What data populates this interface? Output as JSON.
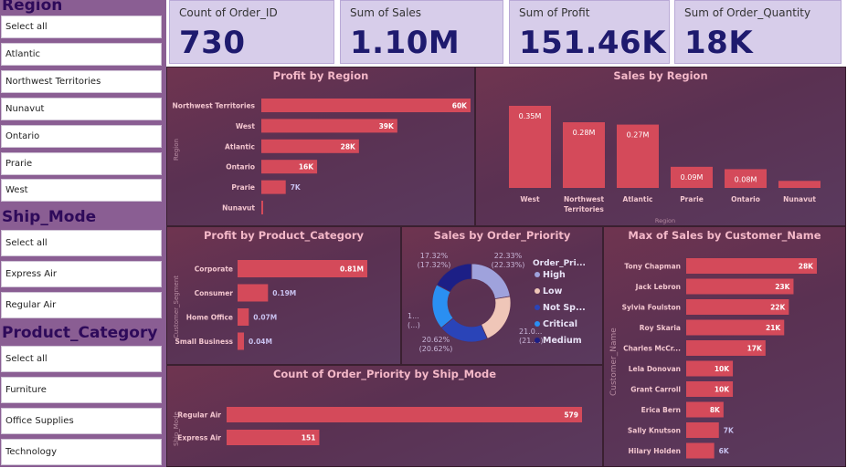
{
  "slicers": {
    "region": {
      "title": "Region",
      "items": [
        "Select all",
        "Atlantic",
        "Northwest Territories",
        "Nunavut",
        "Ontario",
        "Prarie",
        "West"
      ]
    },
    "ship_mode": {
      "title": "Ship_Mode",
      "items": [
        "Select all",
        "Express Air",
        "Regular Air"
      ]
    },
    "product_category": {
      "title": "Product_Category",
      "items": [
        "Select all",
        "Furniture",
        "Office Supplies",
        "Technology"
      ]
    }
  },
  "kpis": [
    {
      "label": "Count of Order_ID",
      "value": "730"
    },
    {
      "label": "Sum of Sales",
      "value": "1.10M"
    },
    {
      "label": "Sum of Profit",
      "value": "151.46K"
    },
    {
      "label": "Sum of Order_Quantity",
      "value": "18K"
    }
  ],
  "colors": {
    "bar": "#d44a5a",
    "slicer_bg": "#8a5e93",
    "kpi_bg": "#d7cdea",
    "kpi_value": "#1e1a6e",
    "title": "#f4b8c8"
  },
  "panels": {
    "profit_by_region": {
      "title": "Profit by Region",
      "axis_label": "Region"
    },
    "sales_by_region": {
      "title": "Sales by Region",
      "axis_label": "Region"
    },
    "profit_by_category": {
      "title": "Profit by Product_Category",
      "axis_label": "Customer_Segment"
    },
    "sales_by_priority": {
      "title": "Sales by Order_Priority",
      "legend_title": "Order_Pri..."
    },
    "max_sales_customer": {
      "title": "Max of Sales by Customer_Name",
      "axis_label": "Customer_Name"
    },
    "priority_by_ship": {
      "title": "Count of Order_Priority by Ship_Mode",
      "axis_label": "Ship_Mode"
    }
  },
  "chart_data": [
    {
      "id": "profit_by_region",
      "type": "bar",
      "orientation": "horizontal",
      "title": "Profit by Region",
      "ylabel": "Region",
      "categories": [
        "Northwest Territories",
        "West",
        "Atlantic",
        "Ontario",
        "Prarie",
        "Nunavut"
      ],
      "values": [
        60000,
        39000,
        28000,
        16000,
        7000,
        500
      ],
      "labels": [
        "60K",
        "39K",
        "28K",
        "16K",
        "7K",
        ""
      ],
      "xlim": [
        0,
        60000
      ]
    },
    {
      "id": "sales_by_region",
      "type": "bar",
      "orientation": "vertical",
      "title": "Sales by Region",
      "xlabel": "Region",
      "categories": [
        "West",
        "Northwest\nTerritories",
        "Atlantic",
        "Prarie",
        "Ontario",
        "Nunavut"
      ],
      "values": [
        0.35,
        0.28,
        0.27,
        0.09,
        0.08,
        0.03
      ],
      "labels": [
        "0.35M",
        "0.28M",
        "0.27M",
        "0.09M",
        "0.08M",
        ""
      ],
      "ylim": [
        0,
        0.35
      ]
    },
    {
      "id": "profit_by_category",
      "type": "bar",
      "orientation": "horizontal",
      "title": "Profit by Product_Category",
      "ylabel": "Customer_Segment",
      "categories": [
        "Corporate",
        "Consumer",
        "Home Office",
        "Small Business"
      ],
      "values": [
        0.81,
        0.19,
        0.07,
        0.04
      ],
      "labels": [
        "0.81M",
        "0.19M",
        "0.07M",
        "0.04M"
      ],
      "xlim": [
        0,
        0.81
      ]
    },
    {
      "id": "sales_by_priority",
      "type": "pie",
      "donut": true,
      "title": "Sales by Order_Priority",
      "legend_title": "Order_Pri...",
      "slices": [
        {
          "name": "High",
          "value": 22.33,
          "color": "#9fa2dc"
        },
        {
          "name": "Low",
          "value": 21.0,
          "color": "#efc6b8"
        },
        {
          "name": "Not Sp...",
          "value": 20.62,
          "color": "#2a44b8"
        },
        {
          "name": "Critical",
          "value": 18.71,
          "color": "#2a8ff2"
        },
        {
          "name": "Medium",
          "value": 17.32,
          "color": "#1c1f86"
        }
      ],
      "outer_labels": [
        {
          "text": "22.33%\n(22.33%)"
        },
        {
          "text": "21.0...\n(21....)"
        },
        {
          "text": "20.62%\n(20.62%)"
        },
        {
          "text": "1...\n(...)"
        },
        {
          "text": "17.32%\n(17.32%)"
        }
      ]
    },
    {
      "id": "max_sales_customer",
      "type": "bar",
      "orientation": "horizontal",
      "title": "Max of Sales by Customer_Name",
      "ylabel": "Customer_Name",
      "categories": [
        "Tony Chapman",
        "Jack Lebron",
        "Sylvia Foulston",
        "Roy Skaria",
        "Charles McCr...",
        "Lela Donovan",
        "Grant Carroll",
        "Erica Bern",
        "Sally Knutson",
        "Hilary Holden"
      ],
      "values": [
        28000,
        23000,
        22000,
        21000,
        17000,
        10000,
        10000,
        8000,
        7000,
        6000
      ],
      "labels": [
        "28K",
        "23K",
        "22K",
        "21K",
        "17K",
        "10K",
        "10K",
        "8K",
        "7K",
        "6K"
      ],
      "xlim": [
        0,
        28000
      ]
    },
    {
      "id": "priority_by_ship",
      "type": "bar",
      "orientation": "horizontal",
      "title": "Count of Order_Priority by Ship_Mode",
      "ylabel": "Ship_Mode",
      "categories": [
        "Regular Air",
        "Express Air"
      ],
      "values": [
        579,
        151
      ],
      "labels": [
        "579",
        "151"
      ],
      "xlim": [
        0,
        579
      ]
    }
  ]
}
